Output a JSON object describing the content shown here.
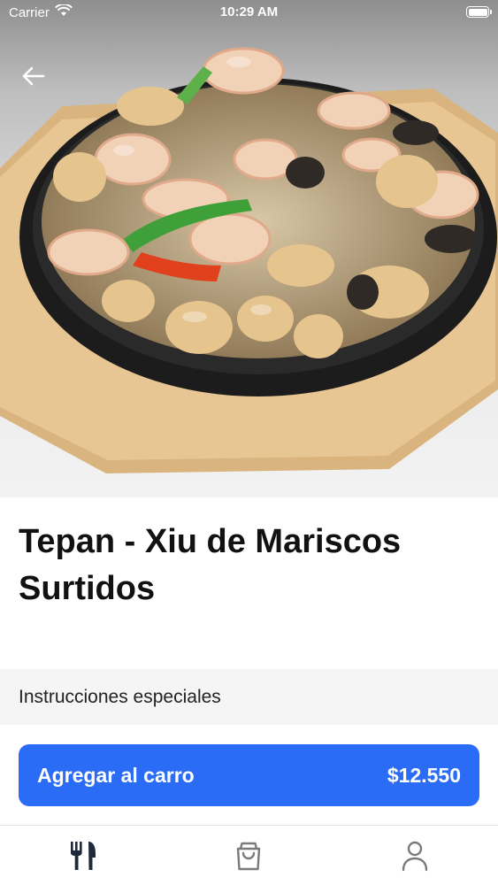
{
  "status_bar": {
    "carrier": "Carrier",
    "time": "10:29 AM"
  },
  "header": {
    "back_icon": "arrow-left-icon"
  },
  "product": {
    "name": "Tepan - Xiu de Mariscos Surtidos",
    "image_icon": "food-photo"
  },
  "instructions": {
    "label": "Instrucciones especiales"
  },
  "cart_button": {
    "label": "Agregar al carro",
    "price": "$12.550",
    "color": "#2a6cf6"
  },
  "tab_bar": {
    "items": [
      {
        "icon": "utensils-icon",
        "active": true
      },
      {
        "icon": "shopping-bag-icon",
        "active": false
      },
      {
        "icon": "user-icon",
        "active": false
      }
    ]
  }
}
